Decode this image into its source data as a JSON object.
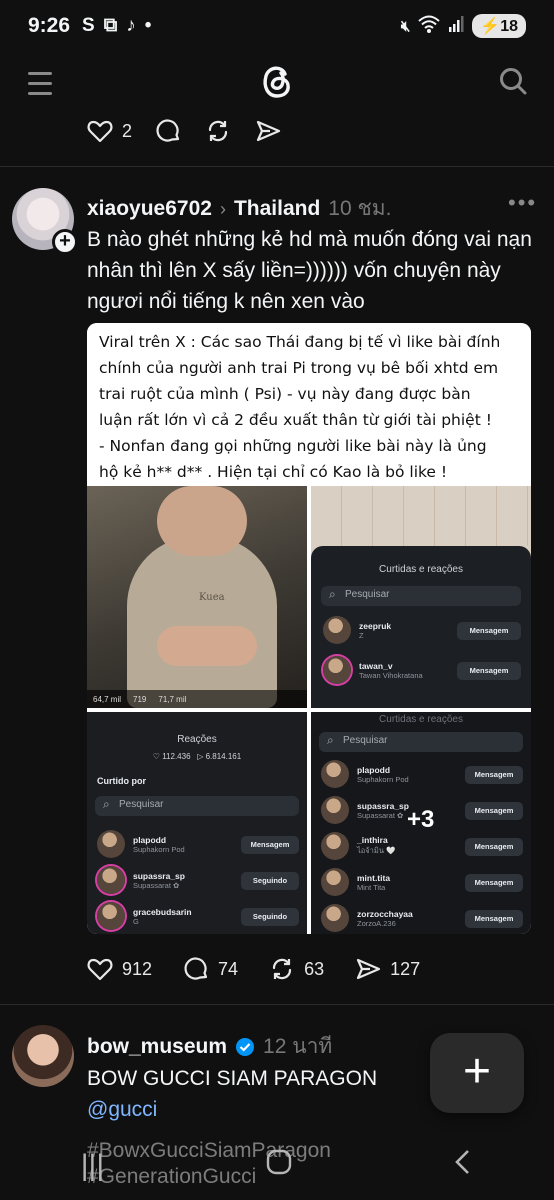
{
  "status_bar": {
    "time": "9:26",
    "battery": "18",
    "left_icons": [
      "S",
      "screenshot-icon",
      "tiktok-icon",
      "•"
    ]
  },
  "top_nav": {
    "menu_icon": "menu-icon",
    "logo": "threads-logo",
    "search_icon": "search-icon"
  },
  "prev_post_actions": {
    "likes": "2"
  },
  "post1": {
    "username": "xiaoyue6702",
    "community": "Thailand",
    "time": "10 ชม.",
    "more": "•••",
    "lines": [
      "B nào ghét những kẻ hd mà muốn đóng vai nạn",
      "nhân thì lên X sấy liền=)))))) vốn chuyện này",
      "ngươi nổi tiếng k nên xen vào"
    ],
    "caption_lines": [
      "Viral trên X : Các sao Thái đang bị tế vì like bài đính",
      "chính của người anh trai Pi trong vụ bê bối xhtd em",
      "trai ruột  của mình ( Psi)  - vụ này đang được bàn",
      "luận rất lớn vì cả 2 đều xuất thân từ giới tài phiệt !",
      "- Nonfan đang gọi những người like bài này là ủng",
      "hộ kẻ h** d** . Hiện tại chỉ có Kao là bỏ like !"
    ],
    "image1": {
      "shirt_text": "Kuea",
      "stats": [
        "64,7 mil",
        "719",
        "71,7 mil"
      ]
    },
    "image2": {
      "title": "Curtidas e reações",
      "search": "Pesquisar",
      "rows": [
        {
          "name": "zeepruk",
          "sub": "Z",
          "button": "Mensagem"
        },
        {
          "name": "tawan_v",
          "sub": "Tawan Vihokratana",
          "button": "Mensagem"
        }
      ]
    },
    "image3": {
      "title": "Reações",
      "likes": "112.436",
      "plays": "6.814.161",
      "section": "Curtido por",
      "search": "Pesquisar",
      "rows": [
        {
          "name": "plapodd",
          "sub": "Suphakorn Pod",
          "button": "Mensagem"
        },
        {
          "name": "supassra_sp",
          "sub": "Supassarat ✿",
          "button": "Seguindo"
        },
        {
          "name": "gracebudsarin",
          "sub": "G",
          "button": "Seguindo"
        }
      ]
    },
    "image4": {
      "title": "Curtidas e reações",
      "search": "Pesquisar",
      "more_count": "+3",
      "rows": [
        {
          "name": "plapodd",
          "sub": "Suphakorn Pod",
          "button": "Mensagem"
        },
        {
          "name": "supassra_sp",
          "sub": "Supassarat ✿",
          "button": "Mensagem"
        },
        {
          "name": "_inthira",
          "sub": "ไอจ้ามิน 🤍",
          "button": "Mensagem"
        },
        {
          "name": "mint.tita",
          "sub": "Mint Tita",
          "button": "Mensagem"
        },
        {
          "name": "zorzocchayaa",
          "sub": "ZorzoA.236",
          "button": "Mensagem"
        }
      ]
    },
    "actions": {
      "likes": "912",
      "replies": "74",
      "reposts": "63",
      "shares": "127"
    }
  },
  "post2": {
    "username": "bow_museum",
    "time": "12 นาที",
    "text": "BOW GUCCI SIAM PARAGON",
    "mention": "@gucci",
    "hashtags": [
      "#BowxGucciSiamParagon",
      "#GenerationGucci"
    ]
  },
  "fab": {
    "label": "+"
  },
  "colors": {
    "background": "#101010",
    "verified": "#0095f6",
    "link": "#7fb6ff"
  }
}
